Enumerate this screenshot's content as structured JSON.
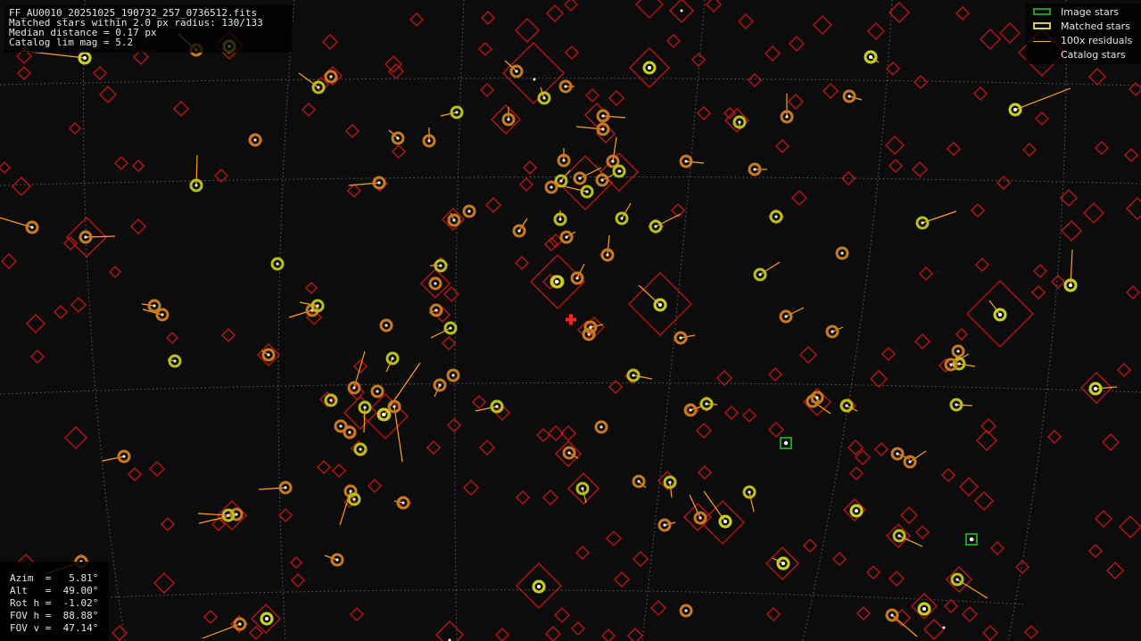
{
  "header": {
    "filename": "FF_AU0010_20251025_190732_257_0736512.fits",
    "matched": "Matched stars within 2.0 px radius: 130/133",
    "median": "Median distance = 0.17 px",
    "limmag": "Catalog lim mag = 5.2"
  },
  "legend": {
    "image_stars": "Image stars",
    "matched_stars": "Matched stars",
    "residuals": "100x residuals",
    "catalog_stars": "Catalog stars"
  },
  "pointing": {
    "azim": "Azim  =   5.81°",
    "alt": "Alt   =  49.00°",
    "rot": "Rot h =  -1.02°",
    "fovh": "FOV h =  88.88°",
    "fovv": "FOV v =  47.14°"
  },
  "colors": {
    "background": "#0c0c0c",
    "grid": "#777777",
    "catalog": "#d01818",
    "matched": "#c8c820",
    "image": "#18a018",
    "residual": "#ffa020",
    "center": "#ff2020"
  }
}
